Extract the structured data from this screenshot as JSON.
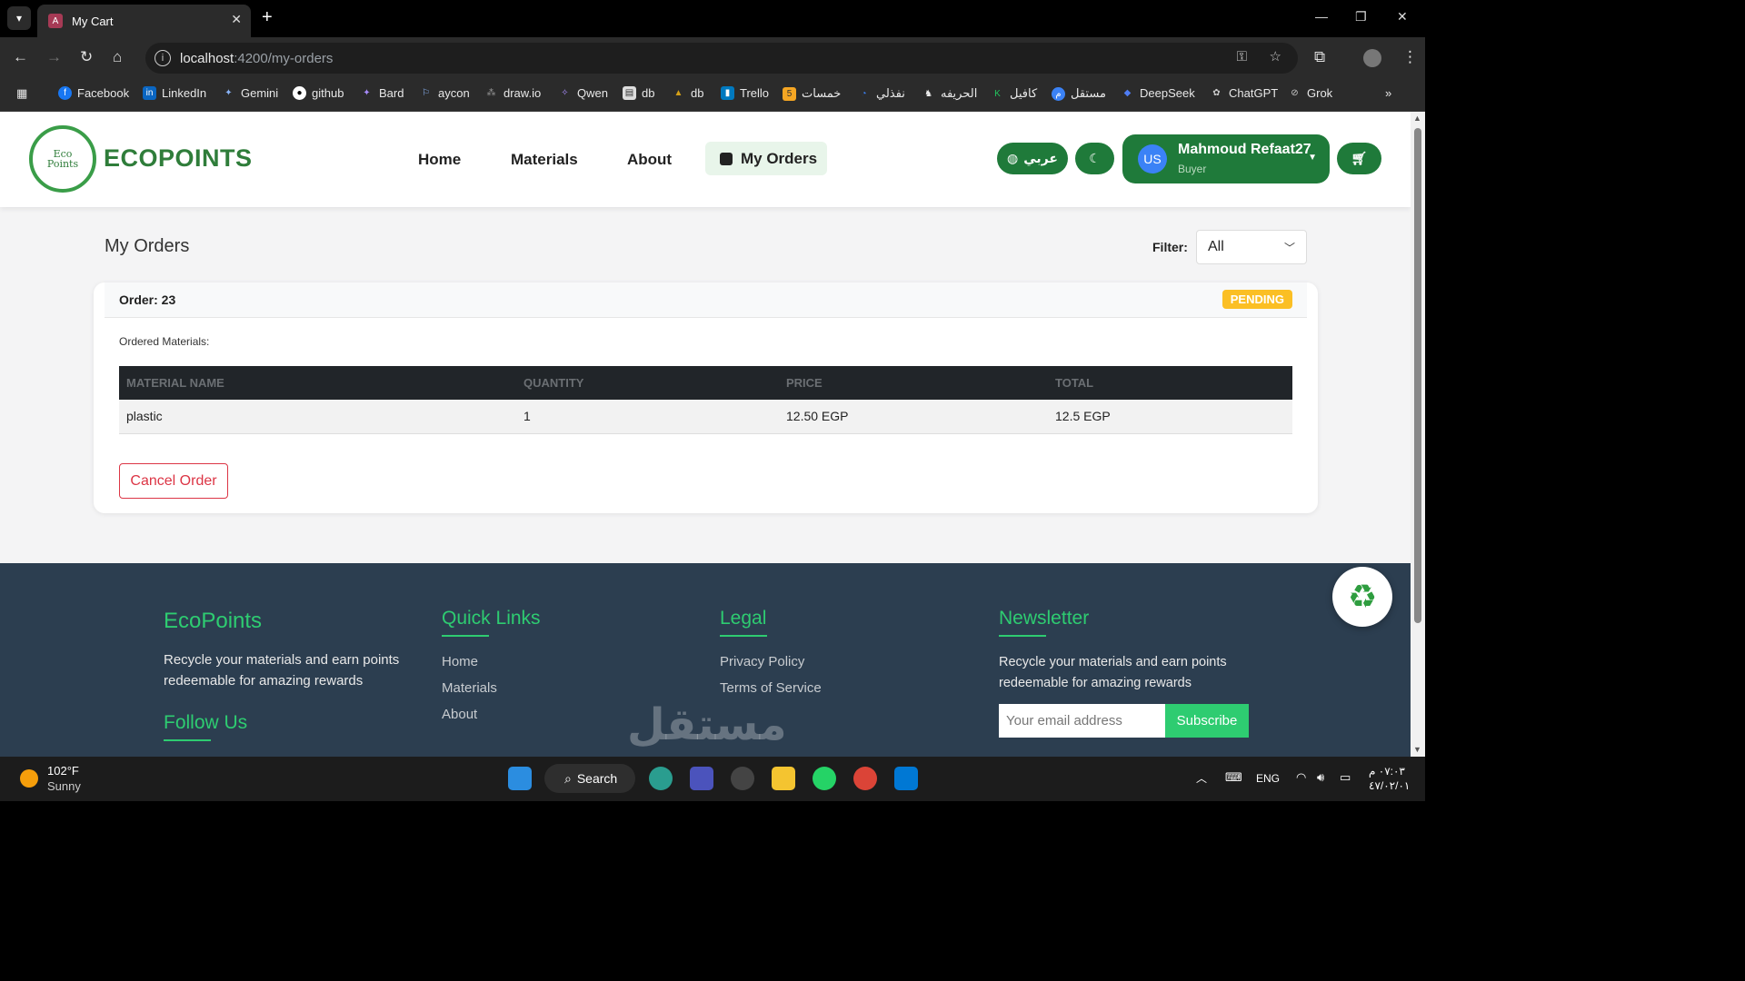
{
  "browser": {
    "tab_title": "My Cart",
    "url_host": "localhost",
    "url_path": ":4200/my-orders",
    "bookmarks": [
      "Facebook",
      "LinkedIn",
      "Gemini",
      "github",
      "Bard",
      "aycon",
      "draw.io",
      "Qwen",
      "db",
      "db",
      "Trello",
      "خمسات",
      "نفذلي",
      "الحريفه",
      "كافيل",
      "مستقل",
      "DeepSeek",
      "ChatGPT",
      "Grok"
    ]
  },
  "header": {
    "logo_top": "Eco",
    "logo_bottom": "Points",
    "brand": "ECOPOINTS",
    "nav": {
      "home": "Home",
      "materials": "Materials",
      "about": "About",
      "my_orders": "My Orders"
    },
    "lang_label": "عربي",
    "user": {
      "initials": "US",
      "name": "Mahmoud Refaat27",
      "role": "Buyer"
    }
  },
  "main": {
    "title": "My Orders",
    "filter_label": "Filter:",
    "filter_value": "All"
  },
  "order": {
    "label": "Order: 23",
    "status": "PENDING",
    "ordered_label": "Ordered Materials:",
    "columns": [
      "MATERIAL NAME",
      "QUANTITY",
      "PRICE",
      "TOTAL"
    ],
    "rows": [
      [
        "plastic",
        "1",
        "12.50 EGP",
        "12.5 EGP"
      ]
    ],
    "cancel_label": "Cancel Order"
  },
  "footer": {
    "brand": "EcoPoints",
    "brand_text": "Recycle your materials and earn points redeemable for amazing rewards",
    "follow": "Follow Us",
    "quick_title": "Quick Links",
    "quick_links": [
      "Home",
      "Materials",
      "About"
    ],
    "legal_title": "Legal",
    "legal_links": [
      "Privacy Policy",
      "Terms of Service"
    ],
    "news_title": "Newsletter",
    "news_text": "Recycle your materials and earn points redeemable for amazing rewards",
    "email_placeholder": "Your email address",
    "subscribe": "Subscribe"
  },
  "taskbar": {
    "temp": "102°F",
    "weather": "Sunny",
    "search": "Search",
    "lang": "ENG",
    "time": "٠٧:٠٣ م",
    "date": "٤٧/٠٢/٠١"
  },
  "watermark": "مستقل"
}
